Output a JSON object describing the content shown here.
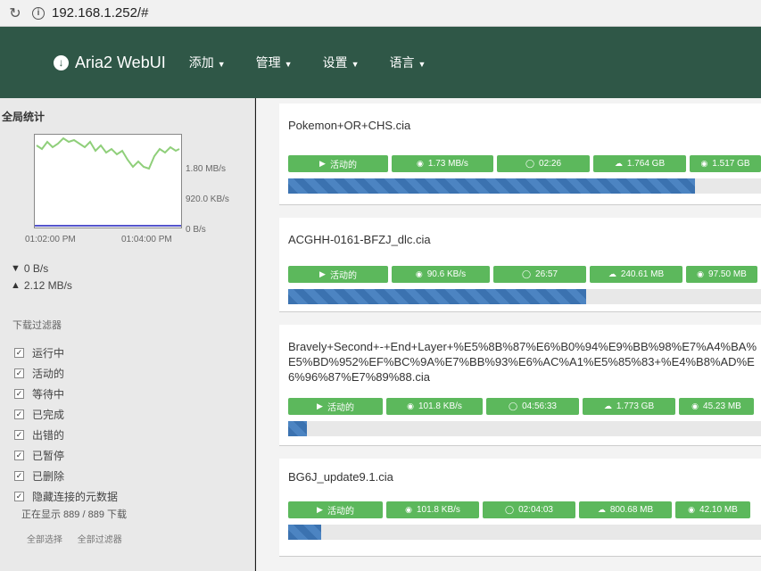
{
  "browser": {
    "url": "192.168.1.252/#"
  },
  "navbar": {
    "brand": "Aria2 WebUI",
    "menu": [
      {
        "label": "添加"
      },
      {
        "label": "管理"
      },
      {
        "label": "设置"
      },
      {
        "label": "语言"
      }
    ]
  },
  "sidebar": {
    "title": "全局统计",
    "graph": {
      "y_ticks": [
        "1.80 MB/s",
        "920.0 KB/s",
        "0 B/s"
      ],
      "x_ticks": [
        "01:02:00 PM",
        "01:04:00 PM"
      ]
    },
    "download_speed": "0 B/s",
    "upload_speed": "2.12 MB/s",
    "filter_title": "下载过滤器",
    "filters": [
      {
        "label": "运行中",
        "checked": true
      },
      {
        "label": "活动的",
        "checked": true
      },
      {
        "label": "等待中",
        "checked": true
      },
      {
        "label": "已完成",
        "checked": true
      },
      {
        "label": "出错的",
        "checked": true
      },
      {
        "label": "已暂停",
        "checked": true
      },
      {
        "label": "已删除",
        "checked": true
      },
      {
        "label": "隐藏连接的元数据",
        "checked": true
      }
    ],
    "showing": "正在显示 889 / 889 下载",
    "links": [
      "全部选择",
      "全部过滤器"
    ]
  },
  "downloads": [
    {
      "name": "Pokemon+OR+CHS.cia",
      "status": "活动的",
      "speed": "1.73 MB/s",
      "eta": "02:26",
      "size": "1.764 GB",
      "downloaded": "1.517 GB",
      "progress": 0.86
    },
    {
      "name": "ACGHH-0161-BFZJ_dlc.cia",
      "status": "活动的",
      "speed": "90.6 KB/s",
      "eta": "26:57",
      "size": "240.61 MB",
      "downloaded": "97.50 MB",
      "progress": 0.63
    },
    {
      "name": "Bravely+Second+-+End+Layer+%E5%8B%87%E6%B0%94%E9%BB%98%E7%A4%BA%E5%BD%952%EF%BC%9A%E7%BB%93%E6%AC%A1%E5%85%83+%E4%B8%AD%E6%96%87%E7%89%88.cia",
      "status": "活动的",
      "speed": "101.8 KB/s",
      "eta": "04:56:33",
      "size": "1.773 GB",
      "downloaded": "45.23 MB",
      "progress": 0.04
    },
    {
      "name": "BG6J_update9.1.cia",
      "status": "活动的",
      "speed": "101.8 KB/s",
      "eta": "02:04:03",
      "size": "800.68 MB",
      "downloaded": "42.10 MB",
      "progress": 0.07
    }
  ],
  "colors": {
    "navbar": "#2f5747",
    "pill": "#5cb85c",
    "progress": "#3b72b0"
  }
}
